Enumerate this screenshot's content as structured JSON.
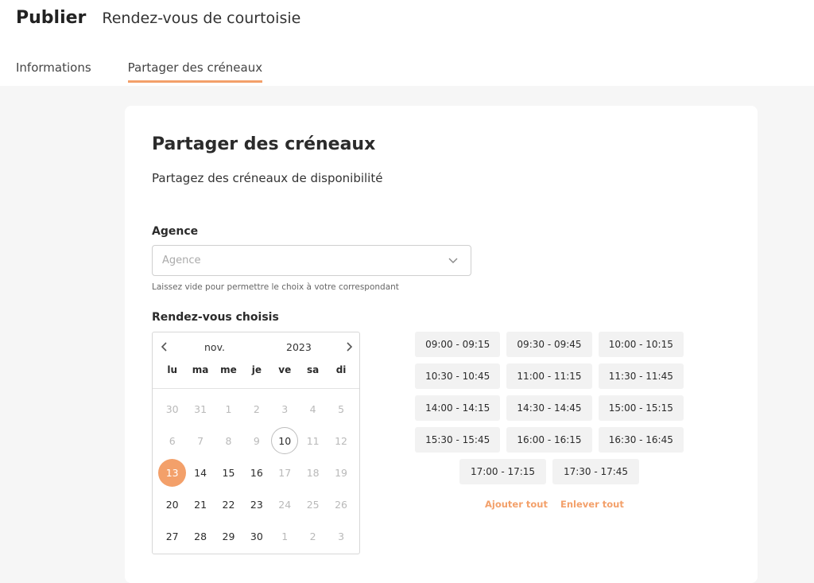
{
  "header": {
    "title": "Publier",
    "subtitle": "Rendez-vous de courtoisie",
    "tabs": [
      {
        "label": "Informations",
        "active": false
      },
      {
        "label": "Partager des créneaux",
        "active": true
      }
    ]
  },
  "card": {
    "title": "Partager des créneaux",
    "description": "Partagez des créneaux de disponibilité"
  },
  "agency": {
    "label": "Agence",
    "placeholder": "Agence",
    "value": "",
    "hint": "Laissez vide pour permettre le choix à votre correspondant"
  },
  "appointments": {
    "label": "Rendez-vous choisis"
  },
  "calendar": {
    "month": "nov.",
    "year": "2023",
    "weekdays": [
      "lu",
      "ma",
      "me",
      "je",
      "ve",
      "sa",
      "di"
    ],
    "days": [
      {
        "d": "30",
        "state": "muted"
      },
      {
        "d": "31",
        "state": "muted"
      },
      {
        "d": "1",
        "state": "muted"
      },
      {
        "d": "2",
        "state": "muted"
      },
      {
        "d": "3",
        "state": "muted"
      },
      {
        "d": "4",
        "state": "muted"
      },
      {
        "d": "5",
        "state": "muted"
      },
      {
        "d": "6",
        "state": "muted"
      },
      {
        "d": "7",
        "state": "muted"
      },
      {
        "d": "8",
        "state": "muted"
      },
      {
        "d": "9",
        "state": "muted"
      },
      {
        "d": "10",
        "state": "today"
      },
      {
        "d": "11",
        "state": "muted"
      },
      {
        "d": "12",
        "state": "muted"
      },
      {
        "d": "13",
        "state": "selected"
      },
      {
        "d": "14",
        "state": "normal"
      },
      {
        "d": "15",
        "state": "normal"
      },
      {
        "d": "16",
        "state": "normal"
      },
      {
        "d": "17",
        "state": "muted"
      },
      {
        "d": "18",
        "state": "muted"
      },
      {
        "d": "19",
        "state": "muted"
      },
      {
        "d": "20",
        "state": "normal"
      },
      {
        "d": "21",
        "state": "normal"
      },
      {
        "d": "22",
        "state": "normal"
      },
      {
        "d": "23",
        "state": "normal"
      },
      {
        "d": "24",
        "state": "muted"
      },
      {
        "d": "25",
        "state": "muted"
      },
      {
        "d": "26",
        "state": "muted"
      },
      {
        "d": "27",
        "state": "normal"
      },
      {
        "d": "28",
        "state": "normal"
      },
      {
        "d": "29",
        "state": "normal"
      },
      {
        "d": "30",
        "state": "normal"
      },
      {
        "d": "1",
        "state": "muted"
      },
      {
        "d": "2",
        "state": "muted"
      },
      {
        "d": "3",
        "state": "muted"
      }
    ]
  },
  "slots": [
    [
      "09:00 - 09:15",
      "09:30 - 09:45",
      "10:00 - 10:15"
    ],
    [
      "10:30 - 10:45",
      "11:00 - 11:15",
      "11:30 - 11:45"
    ],
    [
      "14:00 - 14:15",
      "14:30 - 14:45",
      "15:00 - 15:15"
    ],
    [
      "15:30 - 15:45",
      "16:00 - 16:15",
      "16:30 - 16:45"
    ],
    [
      "17:00 - 17:15",
      "17:30 - 17:45"
    ]
  ],
  "actions": {
    "add_all": "Ajouter tout",
    "remove_all": "Enlever tout"
  },
  "colors": {
    "accent": "#f3a06a",
    "page_background": "#f6f6f6",
    "slot_background": "#f2f2f2"
  }
}
